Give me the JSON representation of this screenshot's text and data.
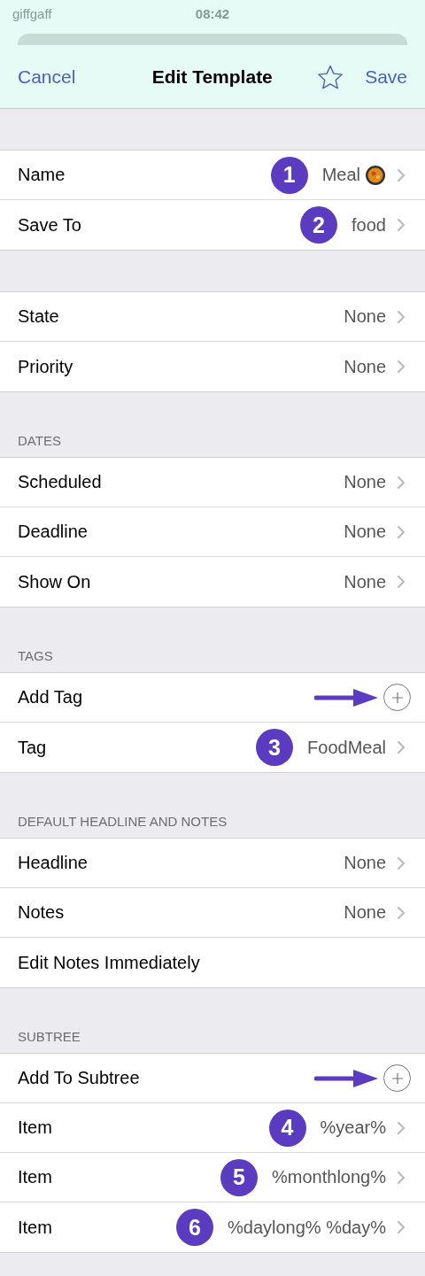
{
  "status_bar": {
    "carrier": "giffgaff",
    "time": "08:42"
  },
  "nav": {
    "cancel": "Cancel",
    "title": "Edit Template",
    "save": "Save"
  },
  "sections": [
    {
      "rows": [
        {
          "kind": "value",
          "label": "Name",
          "value": "Meal",
          "emoji": true,
          "badge": "1"
        },
        {
          "kind": "value",
          "label": "Save To",
          "value": "food",
          "badge": "2"
        }
      ]
    },
    {
      "rows": [
        {
          "kind": "value",
          "label": "State",
          "value": "None"
        },
        {
          "kind": "value",
          "label": "Priority",
          "value": "None"
        }
      ]
    },
    {
      "header": "DATES",
      "rows": [
        {
          "kind": "value",
          "label": "Scheduled",
          "value": "None"
        },
        {
          "kind": "value",
          "label": "Deadline",
          "value": "None"
        },
        {
          "kind": "value",
          "label": "Show On",
          "value": "None"
        }
      ]
    },
    {
      "header": "TAGS",
      "rows": [
        {
          "kind": "add",
          "label": "Add Tag",
          "arrow": true
        },
        {
          "kind": "value",
          "label": "Tag",
          "value": "FoodMeal",
          "badge": "3"
        }
      ]
    },
    {
      "header": "DEFAULT HEADLINE AND NOTES",
      "rows": [
        {
          "kind": "value",
          "label": "Headline",
          "value": "None"
        },
        {
          "kind": "value",
          "label": "Notes",
          "value": "None"
        },
        {
          "kind": "plain",
          "label": "Edit Notes Immediately"
        }
      ]
    },
    {
      "header": "SUBTREE",
      "rows": [
        {
          "kind": "add",
          "label": "Add To Subtree",
          "arrow": true
        },
        {
          "kind": "value",
          "label": "Item",
          "value": "%year%",
          "badge": "4"
        },
        {
          "kind": "value",
          "label": "Item",
          "value": "%monthlong%",
          "badge": "5"
        },
        {
          "kind": "value",
          "label": "Item",
          "value": "%daylong% %day%",
          "badge": "6"
        }
      ]
    }
  ]
}
